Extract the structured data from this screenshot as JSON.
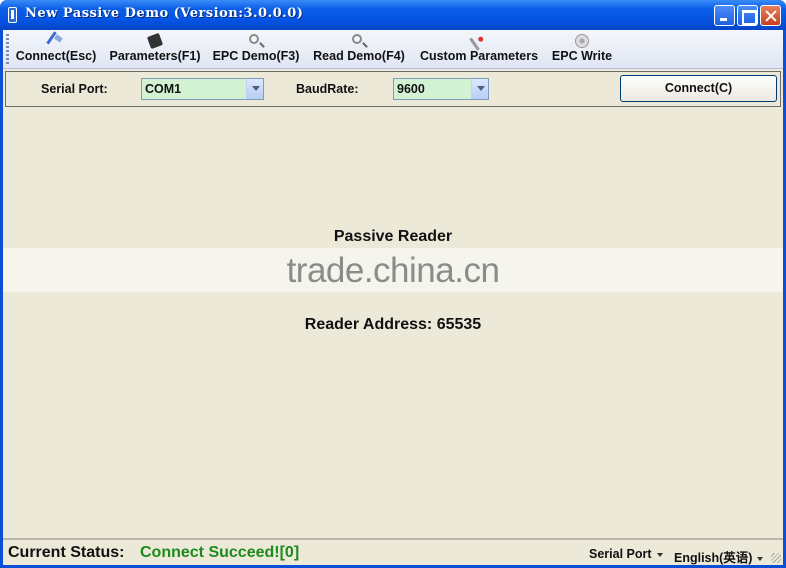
{
  "window": {
    "title": "New Passive Demo (Version:3.0.0.0)"
  },
  "toolbar": {
    "items": [
      {
        "label": "Connect(Esc)",
        "icon": "connect-plug-icon"
      },
      {
        "label": "Parameters(F1)",
        "icon": "chip-icon"
      },
      {
        "label": "EPC Demo(F3)",
        "icon": "magnifier-icon"
      },
      {
        "label": "Read Demo(F4)",
        "icon": "magnifier-icon"
      },
      {
        "label": "Custom Parameters",
        "icon": "tools-icon"
      },
      {
        "label": "EPC Write",
        "icon": "disc-icon"
      }
    ]
  },
  "port_bar": {
    "serial_port_label": "Serial Port:",
    "serial_port_value": "COM1",
    "baud_label": "BaudRate:",
    "baud_value": "9600",
    "connect_button": "Connect(C)"
  },
  "main": {
    "reader_title": "Passive Reader",
    "watermark": "trade.china.cn",
    "reader_address": "Reader Address: 65535"
  },
  "status": {
    "label": "Current Status:",
    "value": "Connect Succeed![0]",
    "value_color": "#1c8a1c",
    "port_dropdown": "Serial Port",
    "language_dropdown": "English(英语)"
  }
}
